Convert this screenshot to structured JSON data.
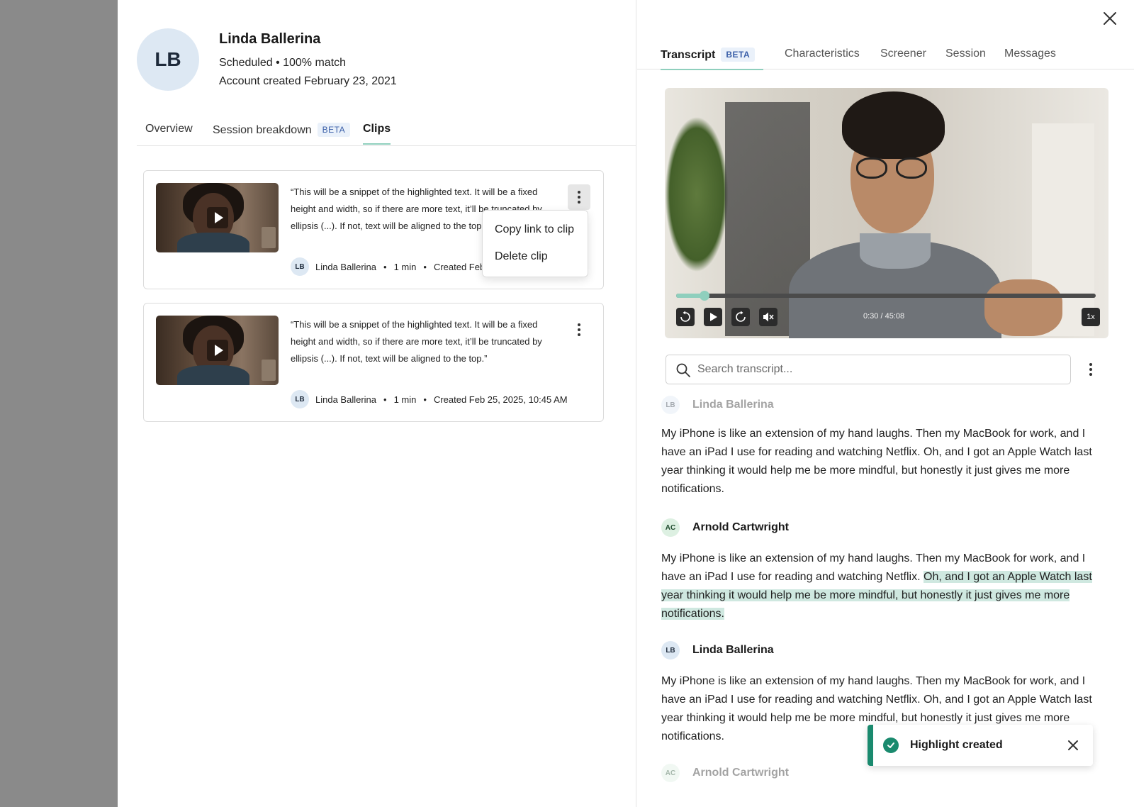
{
  "profile": {
    "initials": "LB",
    "name": "Linda Ballerina",
    "status_line": "Scheduled • 100% match",
    "account_line": "Account created February 23, 2021"
  },
  "left_tabs": {
    "overview": "Overview",
    "session_breakdown": "Session breakdown",
    "session_breakdown_badge": "BETA",
    "clips": "Clips",
    "active": "Clips"
  },
  "clips": [
    {
      "snippet": "“This will be a snippet of the highlighted text. It will be a fixed height and width, so if there are more text, it’ll be truncated by ellipsis (...). If not, text will be aligned to the top.”",
      "author_initials": "LB",
      "author": "Linda Ballerina",
      "duration": "1 min",
      "created": "Created Feb 25, 2025, 10:45 AM"
    },
    {
      "snippet": "“This will be a snippet of the highlighted text. It will be a fixed height and width, so if there are more text, it’ll be truncated by ellipsis (...). If not, text will be aligned to the top.”",
      "author_initials": "LB",
      "author": "Linda Ballerina",
      "duration": "1 min",
      "created": "Created Feb 25, 2025, 10:45 AM"
    }
  ],
  "clip_menu": {
    "copy_link": "Copy link to clip",
    "delete": "Delete clip"
  },
  "right_tabs": {
    "transcript": "Transcript",
    "transcript_badge": "BETA",
    "characteristics": "Characteristics",
    "screener": "Screener",
    "session": "Session",
    "messages": "Messages",
    "active": "Transcript"
  },
  "video": {
    "time": "0:30 / 45:08",
    "playback_rate": "1x",
    "progress_fraction": 0.067
  },
  "search": {
    "placeholder": "Search transcript...",
    "value": ""
  },
  "transcript": [
    {
      "initials": "LB",
      "speaker": "Linda Ballerina",
      "text": "My iPhone is like an extension of my hand laughs. Then my MacBook for work, and I have an iPad I use for reading and watching Netflix. Oh, and I got an Apple Watch last year thinking it would help me be more mindful, but honestly it just gives me more notifications."
    },
    {
      "initials": "AC",
      "speaker": "Arnold Cartwright",
      "text_before": "My iPhone is like an extension of my hand laughs. Then my MacBook for work, and I have an iPad I use for reading and watching Netflix. ",
      "text_highlight": "Oh, and I got an Apple Watch last year thinking it would help me be more mindful, but honestly it just gives me more notifications."
    },
    {
      "initials": "LB",
      "speaker": "Linda Ballerina",
      "text": "My iPhone is like an extension of my hand laughs. Then my MacBook for work, and I have an iPad I use for reading and watching Netflix. Oh, and I got an Apple Watch last year thinking it would help me be more mindful, but honestly it just gives me more notifications."
    },
    {
      "initials": "AC",
      "speaker": "Arnold Cartwright"
    }
  ],
  "toast": {
    "message": "Highlight created"
  },
  "icons": {
    "close": "close-icon",
    "search": "search-icon",
    "more": "more-vertical-icon",
    "play": "play-icon",
    "rewind": "rewind-10-icon",
    "forward": "forward-10-icon",
    "mute": "mute-icon",
    "check": "check-circle-icon"
  },
  "colors": {
    "accent": "#8fcfbd",
    "highlight": "#cfe8e0",
    "success": "#1a8a6e",
    "badge_text": "#3a5fa8"
  }
}
